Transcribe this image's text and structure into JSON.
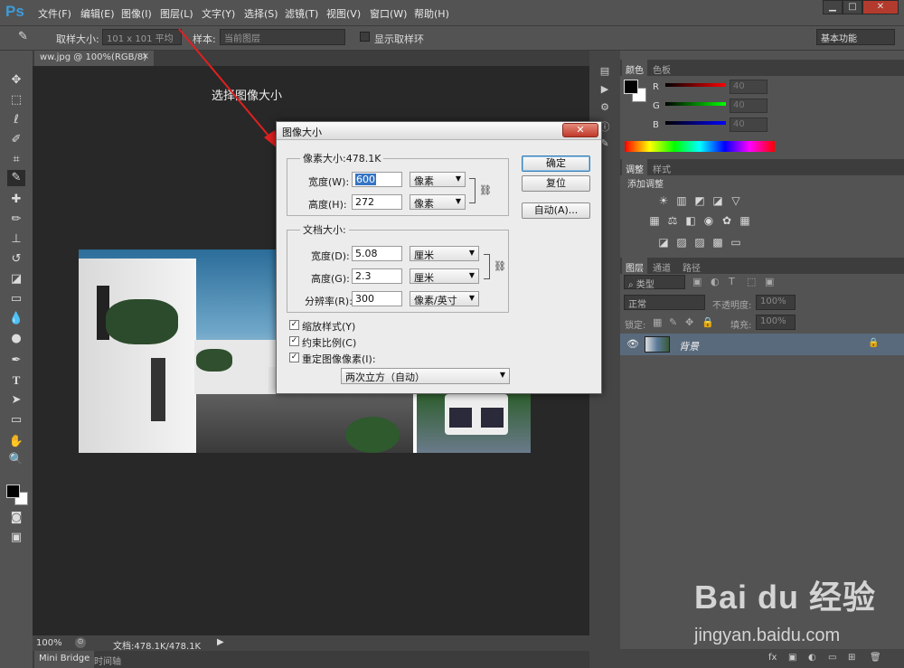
{
  "app": {
    "logo": "Ps"
  },
  "menu": [
    "文件(F)",
    "编辑(E)",
    "图像(I)",
    "图层(L)",
    "文字(Y)",
    "选择(S)",
    "滤镜(T)",
    "视图(V)",
    "窗口(W)",
    "帮助(H)"
  ],
  "window_controls": {
    "minimize": "▁",
    "maximize": "□",
    "close": "✕"
  },
  "options_bar": {
    "sample_size_label": "取样大小:",
    "sample_size_value": "101 x 101 平均",
    "sample_label": "样本:",
    "sample_value": "当前图层",
    "show_ring_label": "显示取样环",
    "workspace": "基本功能"
  },
  "document": {
    "tab_title": "ww.jpg @ 100%(RGB/8)",
    "tab_close": "×",
    "annotation": "选择图像大小",
    "zoom": "100%",
    "doc_info": "文档:478.1K/478.1K"
  },
  "bottom_tabs": [
    "Mini Bridge",
    "时间轴"
  ],
  "dialog": {
    "title": "图像大小",
    "close": "✕",
    "pixel_group": "像素大小:478.1K",
    "width_label": "宽度(W):",
    "width_value": "600",
    "width_unit": "像素",
    "height_label": "高度(H):",
    "height_value": "272",
    "height_unit": "像素",
    "doc_group": "文档大小:",
    "doc_width_label": "宽度(D):",
    "doc_width_value": "5.08",
    "doc_width_unit": "厘米",
    "doc_height_label": "高度(G):",
    "doc_height_value": "2.3",
    "doc_height_unit": "厘米",
    "resolution_label": "分辨率(R):",
    "resolution_value": "300",
    "resolution_unit": "像素/英寸",
    "scale_styles": "缩放样式(Y)",
    "constrain": "约束比例(C)",
    "resample": "重定图像像素(I):",
    "resample_method": "两次立方（自动）",
    "ok": "确定",
    "reset": "复位",
    "auto": "自动(A)..."
  },
  "color_panel": {
    "tabs": [
      "颜色",
      "色板"
    ],
    "r_label": "R",
    "g_label": "G",
    "b_label": "B",
    "r_value": "40",
    "g_value": "40",
    "b_value": "40"
  },
  "adjust_panel": {
    "tabs": [
      "调整",
      "样式"
    ],
    "title": "添加调整"
  },
  "layers_panel": {
    "tabs": [
      "图层",
      "通道",
      "路径"
    ],
    "filter_kind": "类型",
    "blend_mode": "正常",
    "opacity_label": "不透明度:",
    "opacity_value": "100%",
    "lock_label": "锁定:",
    "fill_label": "填充:",
    "fill_value": "100%",
    "layer_name": "背景"
  },
  "watermark": {
    "brand": "Bai du 经验",
    "url": "jingyan.baidu.com"
  }
}
